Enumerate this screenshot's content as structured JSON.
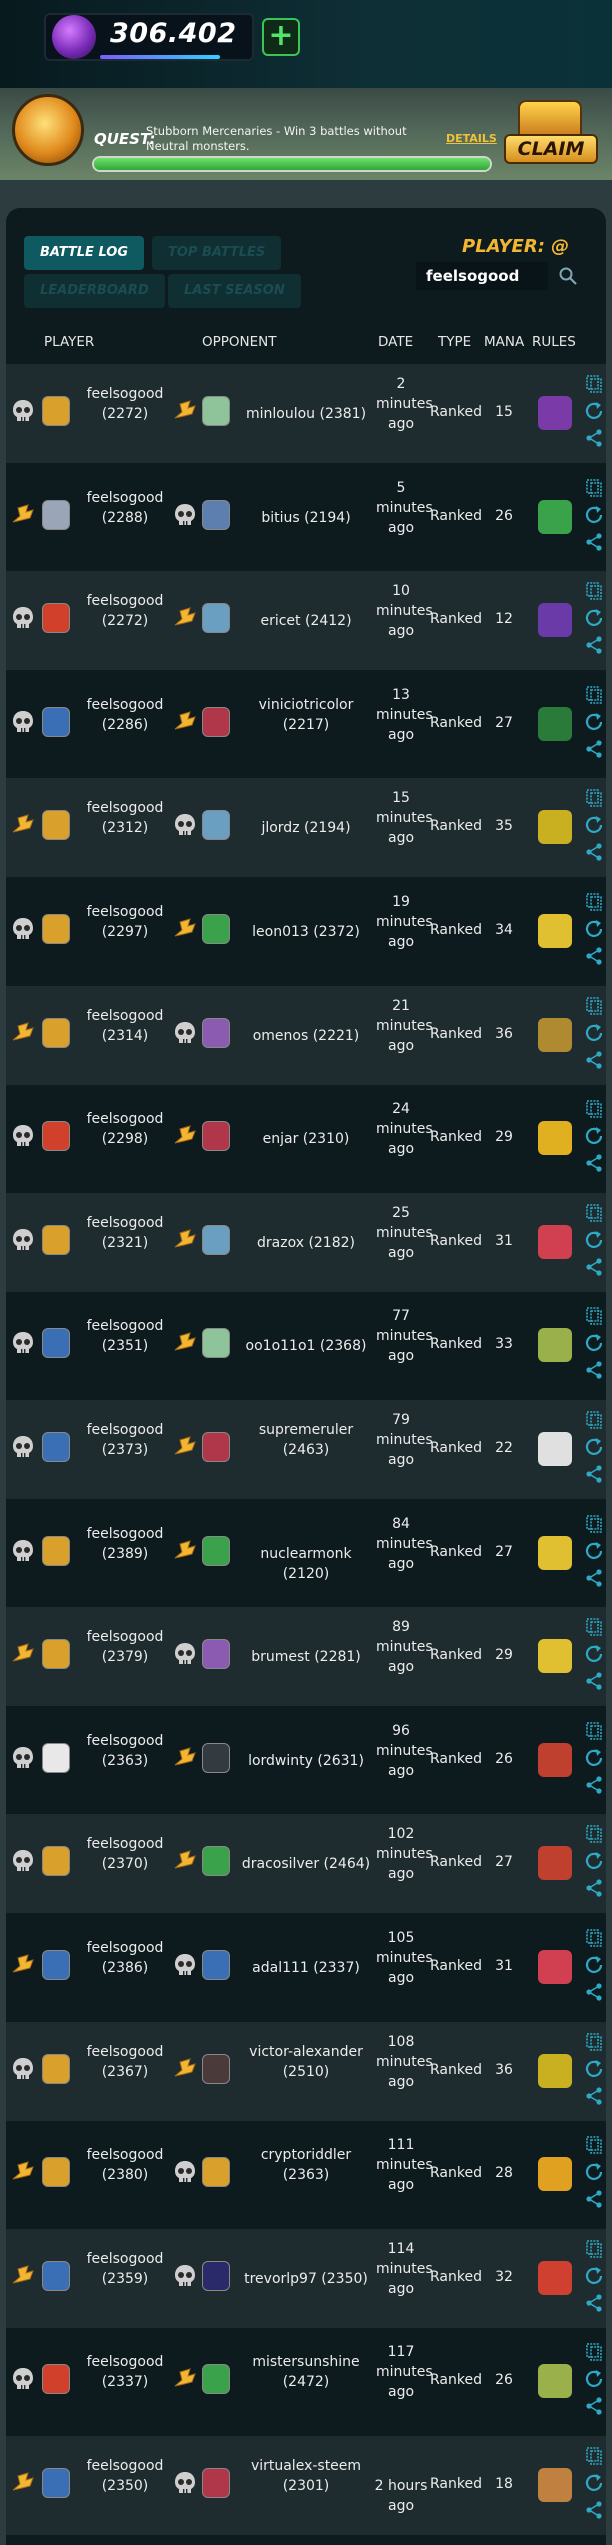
{
  "wallet": {
    "amount": "306.402",
    "add_label": "+"
  },
  "quest": {
    "label": "QUEST:",
    "text": "Stubborn Mercenaries - Win 3 battles without Neutral monsters.",
    "details_label": "DETAILS",
    "progress": 1.0,
    "claim_label": "CLAIM"
  },
  "tabs": {
    "battle_log": "BATTLE LOG",
    "top_battles": "TOP BATTLES",
    "leaderboard": "LEADERBOARD",
    "last_season": "LAST SEASON"
  },
  "search": {
    "label": "PLAYER: @",
    "value": "feelsogood"
  },
  "columns": {
    "player": "PLAYER",
    "opponent": "OPPONENT",
    "date": "DATE",
    "type": "TYPE",
    "mana": "MANA",
    "rules": "RULES"
  },
  "battles": [
    {
      "player_name": "feelsogood",
      "player_rating": "(2272)",
      "player_won": false,
      "player_color": "#d9a12b",
      "opponent": "minloulou (2381)",
      "opp_color": "#8fc49a",
      "date": "2 minutes ago",
      "type": "Ranked",
      "mana": "15"
    },
    {
      "player_name": "feelsogood",
      "player_rating": "(2288)",
      "player_won": true,
      "player_color": "#9aa6b8",
      "opponent": "bitius (2194)",
      "opp_color": "#5c7fb0",
      "date": "5 minutes ago",
      "type": "Ranked",
      "mana": "26"
    },
    {
      "player_name": "feelsogood",
      "player_rating": "(2272)",
      "player_won": false,
      "player_color": "#d0402a",
      "opponent": "ericet (2412)",
      "opp_color": "#6a9fc2",
      "date": "10 minutes ago",
      "type": "Ranked",
      "mana": "12"
    },
    {
      "player_name": "feelsogood",
      "player_rating": "(2286)",
      "player_won": false,
      "player_color": "#3b6fb5",
      "opponent": "viniciotricolor (2217)",
      "opp_color": "#b0364a",
      "date": "13 minutes ago",
      "type": "Ranked",
      "mana": "27"
    },
    {
      "player_name": "feelsogood",
      "player_rating": "(2312)",
      "player_won": true,
      "player_color": "#d9a12b",
      "opponent": "jlordz (2194)",
      "opp_color": "#6a9fc2",
      "date": "15 minutes ago",
      "type": "Ranked",
      "mana": "35"
    },
    {
      "player_name": "feelsogood",
      "player_rating": "(2297)",
      "player_won": false,
      "player_color": "#d9a12b",
      "opponent": "leon013 (2372)",
      "opp_color": "#3aa24a",
      "date": "19 minutes ago",
      "type": "Ranked",
      "mana": "34"
    },
    {
      "player_name": "feelsogood",
      "player_rating": "(2314)",
      "player_won": true,
      "player_color": "#d9a12b",
      "opponent": "omenos (2221)",
      "opp_color": "#8a5bb0",
      "date": "21 minutes ago",
      "type": "Ranked",
      "mana": "36"
    },
    {
      "player_name": "feelsogood",
      "player_rating": "(2298)",
      "player_won": false,
      "player_color": "#d0402a",
      "opponent": "enjar (2310)",
      "opp_color": "#b0364a",
      "date": "24 minutes ago",
      "type": "Ranked",
      "mana": "29"
    },
    {
      "player_name": "feelsogood",
      "player_rating": "(2321)",
      "player_won": false,
      "player_color": "#d9a12b",
      "opponent": "drazox (2182)",
      "opp_color": "#6a9fc2",
      "date": "25 minutes ago",
      "type": "Ranked",
      "mana": "31"
    },
    {
      "player_name": "feelsogood",
      "player_rating": "(2351)",
      "player_won": false,
      "player_color": "#3b6fb5",
      "opponent": "oo1o11o1 (2368)",
      "opp_color": "#8fc49a",
      "date": "77 minutes ago",
      "type": "Ranked",
      "mana": "33"
    },
    {
      "player_name": "feelsogood",
      "player_rating": "(2373)",
      "player_won": false,
      "player_color": "#3b6fb5",
      "opponent": "supremeruler (2463)",
      "opp_color": "#b0364a",
      "date": "79 minutes ago",
      "type": "Ranked",
      "mana": "22"
    },
    {
      "player_name": "feelsogood",
      "player_rating": "(2389)",
      "player_won": false,
      "player_color": "#d9a12b",
      "opponent": "nuclearmonk (2120)",
      "opp_color": "#3aa24a",
      "date": "84 minutes ago",
      "type": "Ranked",
      "mana": "27"
    },
    {
      "player_name": "feelsogood",
      "player_rating": "(2379)",
      "player_won": true,
      "player_color": "#d9a12b",
      "opponent": "brumest (2281)",
      "opp_color": "#8a5bb0",
      "date": "89 minutes ago",
      "type": "Ranked",
      "mana": "29"
    },
    {
      "player_name": "feelsogood",
      "player_rating": "(2363)",
      "player_won": false,
      "player_color": "#e8e8e8",
      "opponent": "lordwinty (2631)",
      "opp_color": "#333a40",
      "date": "96 minutes ago",
      "type": "Ranked",
      "mana": "26"
    },
    {
      "player_name": "feelsogood",
      "player_rating": "(2370)",
      "player_won": false,
      "player_color": "#d9a12b",
      "opponent": "dracosilver (2464)",
      "opp_color": "#3aa24a",
      "date": "102 minutes ago",
      "type": "Ranked",
      "mana": "27"
    },
    {
      "player_name": "feelsogood",
      "player_rating": "(2386)",
      "player_won": true,
      "player_color": "#3b6fb5",
      "opponent": "adal111 (2337)",
      "opp_color": "#3b6fb5",
      "date": "105 minutes ago",
      "type": "Ranked",
      "mana": "31"
    },
    {
      "player_name": "feelsogood",
      "player_rating": "(2367)",
      "player_won": false,
      "player_color": "#d9a12b",
      "opponent": "victor-alexander (2510)",
      "opp_color": "#4a3a3a",
      "date": "108 minutes ago",
      "type": "Ranked",
      "mana": "36"
    },
    {
      "player_name": "feelsogood",
      "player_rating": "(2380)",
      "player_won": true,
      "player_color": "#d9a12b",
      "opponent": "cryptoriddler (2363)",
      "opp_color": "#d9a12b",
      "date": "111 minutes ago",
      "type": "Ranked",
      "mana": "28"
    },
    {
      "player_name": "feelsogood",
      "player_rating": "(2359)",
      "player_won": true,
      "player_color": "#3b6fb5",
      "opponent": "trevorlp97 (2350)",
      "opp_color": "#2a2a6a",
      "date": "114 minutes ago",
      "type": "Ranked",
      "mana": "32"
    },
    {
      "player_name": "feelsogood",
      "player_rating": "(2337)",
      "player_won": false,
      "player_color": "#d0402a",
      "opponent": "mistersunshine (2472)",
      "opp_color": "#3aa24a",
      "date": "117 minutes ago",
      "type": "Ranked",
      "mana": "26"
    },
    {
      "player_name": "feelsogood",
      "player_rating": "(2350)",
      "player_won": true,
      "player_color": "#3b6fb5",
      "opponent": "virtualex-steem (2301)",
      "opp_color": "#b0364a",
      "date": "2 hours ago",
      "type": "Ranked",
      "mana": "18"
    }
  ],
  "rule_colors": [
    "#7a3aa8",
    "#3aa24a",
    "#6a3aa8",
    "#2a7a3a",
    "#c8b020",
    "#e0c030",
    "#b08a30",
    "#e0b020",
    "#d04050",
    "#9ab04a",
    "#e0e0e0",
    "#e0c030",
    "#e0c030",
    "#c04030",
    "#c04030",
    "#d04050",
    "#c8b020",
    "#e0a020",
    "#d04030",
    "#9ab04a",
    "#c08040"
  ],
  "icons": {
    "skull": "skull-icon",
    "win": "trophy-horn-icon",
    "copy": "copy-icon",
    "replay": "replay-icon",
    "share": "share-icon",
    "search": "search-icon"
  }
}
